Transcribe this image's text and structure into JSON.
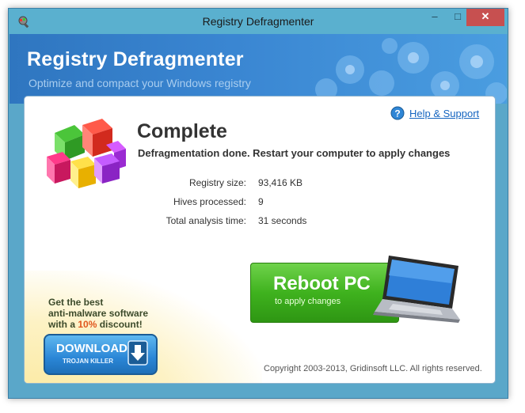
{
  "window": {
    "title": "Registry Defragmenter",
    "controls": {
      "minimize": "–",
      "maximize": "□",
      "close": "✕"
    }
  },
  "banner": {
    "title": "Registry Defragmenter",
    "subtitle": "Optimize and compact your Windows registry"
  },
  "help": {
    "label": "Help & Support",
    "icon": "help-icon"
  },
  "status": {
    "title": "Complete",
    "message": "Defragmentation done. Restart your computer to apply changes"
  },
  "stats": [
    {
      "label": "Registry size:",
      "value": "93,416 KB"
    },
    {
      "label": "Hives processed:",
      "value": "9"
    },
    {
      "label": "Total analysis time:",
      "value": "31 seconds"
    }
  ],
  "reboot": {
    "title": "Reboot PC",
    "subtitle": "to apply changes"
  },
  "promo": {
    "line1": "Get the best",
    "line2": "anti-malware software",
    "line3_prefix": "with a ",
    "line3_highlight": "10%",
    "line3_suffix": " discount!",
    "download_label": "DOWNLOAD",
    "download_sub": "TROJAN KILLER"
  },
  "footer": {
    "copyright": "Copyright 2003-2013, Gridinsoft LLC. All rights reserved."
  },
  "colors": {
    "accent_green": "#3fb21e",
    "link_blue": "#1565c0",
    "banner_blue": "#3a86d2",
    "promo_orange": "#e0561c"
  }
}
